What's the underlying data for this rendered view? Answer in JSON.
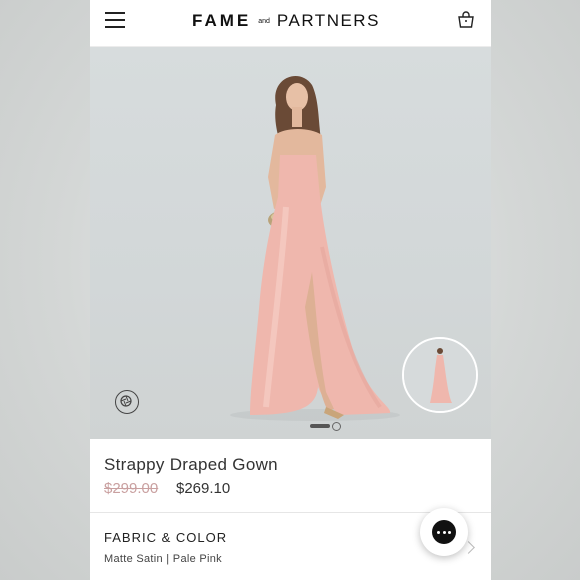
{
  "header": {
    "menu_icon": "hamburger-menu-icon",
    "logo": {
      "part1": "FAME",
      "part2": "and",
      "part3": "PARTNERS"
    },
    "bag_icon": "shopping-bag-icon"
  },
  "hero": {
    "view360_icon": "rotate-360-icon",
    "thumbnail_alt": "full-length-view-thumbnail"
  },
  "product": {
    "title": "Strappy Draped Gown",
    "original_price": "$299.00",
    "sale_price": "$269.10"
  },
  "fabric": {
    "label": "FABRIC & COLOR",
    "value": "Matte Satin | Pale Pink"
  },
  "chat": {
    "icon": "chat-bubble-icon"
  },
  "colors": {
    "dress": "#efb7ad",
    "strike": "#c9a0a0",
    "text": "#333333"
  }
}
